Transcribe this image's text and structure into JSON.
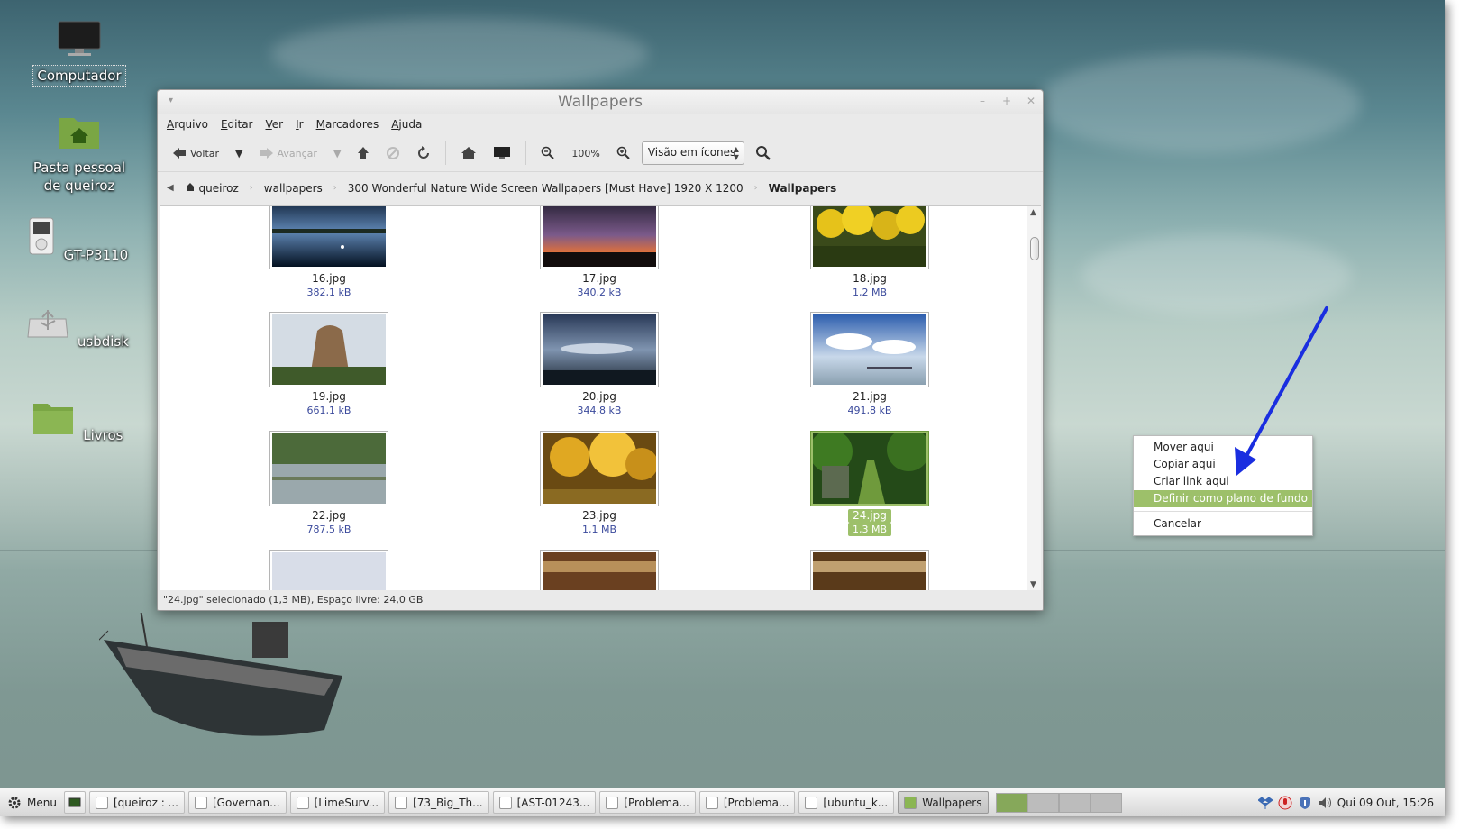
{
  "desktop": {
    "icons": [
      {
        "label": "Computador",
        "icon": "computer-icon"
      },
      {
        "label": "Pasta pessoal de queiroz",
        "icon": "home-folder-icon"
      },
      {
        "label": "GT-P3110",
        "icon": "media-player-icon"
      },
      {
        "label": "usbdisk",
        "icon": "usb-drive-icon"
      },
      {
        "label": "Livros",
        "icon": "folder-icon"
      }
    ]
  },
  "window": {
    "title": "Wallpapers",
    "menu": [
      "Arquivo",
      "Editar",
      "Ver",
      "Ir",
      "Marcadores",
      "Ajuda"
    ],
    "toolbar": {
      "back_label": "Voltar",
      "forward_label": "Avançar",
      "zoom_level": "100%",
      "view_mode": "Visão em ícones"
    },
    "breadcrumb": [
      "queiroz",
      "wallpapers",
      "300 Wonderful Nature Wide Screen Wallpapers [Must Have] 1920 X 1200",
      "Wallpapers"
    ],
    "files": [
      {
        "name": "16.jpg",
        "size": "382,1 kB",
        "selected": false
      },
      {
        "name": "17.jpg",
        "size": "340,2 kB",
        "selected": false
      },
      {
        "name": "18.jpg",
        "size": "1,2 MB",
        "selected": false
      },
      {
        "name": "19.jpg",
        "size": "661,1 kB",
        "selected": false
      },
      {
        "name": "20.jpg",
        "size": "344,8 kB",
        "selected": false
      },
      {
        "name": "21.jpg",
        "size": "491,8 kB",
        "selected": false
      },
      {
        "name": "22.jpg",
        "size": "787,5 kB",
        "selected": false
      },
      {
        "name": "23.jpg",
        "size": "1,1 MB",
        "selected": false
      },
      {
        "name": "24.jpg",
        "size": "1,3 MB",
        "selected": true
      }
    ],
    "statusbar": "\"24.jpg\" selecionado (1,3 MB), Espaço livre: 24,0 GB"
  },
  "context_menu": {
    "items": [
      "Mover aqui",
      "Copiar aqui",
      "Criar link aqui",
      "Definir como plano de fundo",
      "Cancelar"
    ],
    "highlighted": "Definir como plano de fundo"
  },
  "panel": {
    "menu_label": "Menu",
    "tasks": [
      "[queiroz : ...",
      "[Governan...",
      "[LimeSurv...",
      "[73_Big_Th...",
      "[AST-01243...",
      "[Problema...",
      "[Problema...",
      "[ubuntu_k...",
      "Wallpapers"
    ],
    "active_task": "Wallpapers",
    "clock": "Qui 09 Out, 15:26"
  },
  "colors": {
    "selection_green": "#9dc06a",
    "annotation_arrow": "#1a2ee0",
    "size_text": "#3b4a9c"
  }
}
